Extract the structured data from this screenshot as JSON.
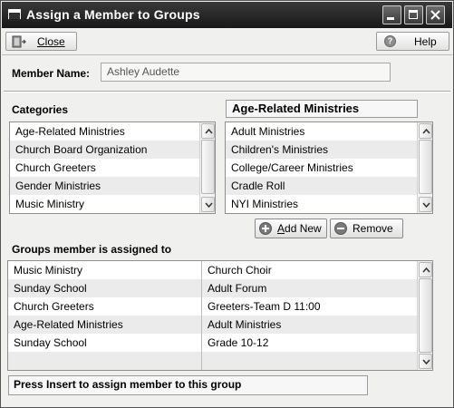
{
  "window": {
    "title": "Assign a Member to Groups"
  },
  "toolbar": {
    "close_label": "Close",
    "help_label": "Help"
  },
  "member": {
    "label": "Member Name:",
    "value": "Ashley Audette"
  },
  "categories": {
    "label": "Categories",
    "items": [
      "Age-Related Ministries",
      "Church Board Organization",
      "Church Greeters",
      "Gender Ministries",
      "Music Ministry"
    ]
  },
  "ministries": {
    "header": "Age-Related Ministries",
    "items": [
      "Adult Ministries",
      "Children's Ministries",
      "College/Career Ministries",
      "Cradle Roll",
      "NYI Ministries"
    ]
  },
  "actions": {
    "add_new_prefix": "A",
    "add_new_rest": "dd New",
    "remove_label": "Remove"
  },
  "assigned": {
    "label": "Groups member is assigned to",
    "rows": [
      {
        "category": "Music Ministry",
        "group": "Church Choir"
      },
      {
        "category": "Sunday School",
        "group": "Adult Forum"
      },
      {
        "category": "Church Greeters",
        "group": "Greeters-Team D  11:00"
      },
      {
        "category": "Age-Related Ministries",
        "group": "Adult Ministries"
      },
      {
        "category": "Sunday School",
        "group": "Grade 10-12"
      }
    ]
  },
  "status": {
    "text": "Press Insert to assign member to this group"
  }
}
